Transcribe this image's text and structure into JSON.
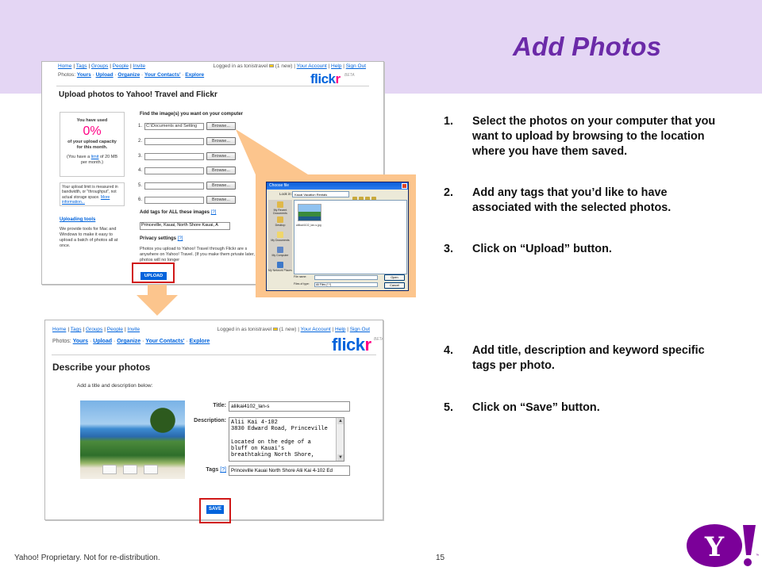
{
  "slide": {
    "title": "Add Photos",
    "footer": "Yahoo! Proprietary.   Not for re-distribution.",
    "page_number": "15",
    "logo_text": "Y!",
    "colors": {
      "header_band": "#e4d6f4",
      "title": "#6b2aa8",
      "highlight": "#d01818",
      "callout": "#fcc58d",
      "yahoo_purple": "#7b0099"
    }
  },
  "steps": [
    {
      "num": "1.",
      "text": "Select the photos on your computer that you want to upload by browsing to the location where you have them saved."
    },
    {
      "num": "2.",
      "text": "Add any tags that you’d like to have associated with the selected photos."
    },
    {
      "num": "3.",
      "text": "Click on “Upload” button."
    },
    {
      "num": "4.",
      "text": "Add title, description and keyword specific tags per photo."
    },
    {
      "num": "5.",
      "text": "Click on “Save” button."
    }
  ],
  "flickr_nav": {
    "links": [
      "Home",
      "Tags",
      "Groups",
      "People",
      "Invite"
    ],
    "logged_in": "Logged in as tonistravel",
    "mail": "(1 new)",
    "right_links": [
      "Your Account",
      "Help",
      "Sign Out"
    ],
    "photos_label": "Photos:",
    "photos_links": [
      "Yours",
      "Upload",
      "Organize",
      "Your Contacts'",
      "Explore"
    ],
    "logo_flick": "flick",
    "logo_r": "r",
    "beta": "BETA"
  },
  "upload_page": {
    "heading": "Upload photos to Yahoo! Travel and Flickr",
    "usage_line1": "You have used",
    "usage_pct": "0%",
    "usage_line2": "of your upload capacity for this month.",
    "usage_note_a": "(You have a",
    "usage_note_link": "limit",
    "usage_note_b": "of 20 MB per month.)",
    "limit_note": "Your upload limit is measured in bandwidth, or \"throughput\", not actual storage space.",
    "more_info": "More information...",
    "tools_heading": "Uploading tools",
    "tools_text": "We provide tools for Mac and Windows to make it easy to upload a batch of photos all at once.",
    "find_heading": "Find the image(s) you want on your computer",
    "files": [
      {
        "num": "1.",
        "value": "C:\\Documents and Setting"
      },
      {
        "num": "2.",
        "value": ""
      },
      {
        "num": "3.",
        "value": ""
      },
      {
        "num": "4.",
        "value": ""
      },
      {
        "num": "5.",
        "value": ""
      },
      {
        "num": "6.",
        "value": ""
      }
    ],
    "browse_label": "Browse...",
    "tags_heading": "Add tags for ALL these images",
    "help_link": "[?]",
    "tags_value": "Princeville, Kauai, North Shore Kauai, A",
    "privacy_heading": "Privacy settings",
    "privacy_text": "Photos you upload to Yahoo! Travel through Flickr are s anywhere on Yahoo! Travel. (If you make them private later, the photos will no longer",
    "upload_button": "UPLOAD"
  },
  "file_dialog": {
    "title": "Choose file",
    "look_in_label": "Look in:",
    "look_in_value": "Kauai Vacation Rentals",
    "places": [
      "My Recent Documents",
      "Desktop",
      "My Documents",
      "My Computer",
      "My Network Places"
    ],
    "file_caption": "aliikai4102_lan-s.jpg",
    "file_name_label": "File name:",
    "file_type_label": "Files of type:",
    "file_type_value": "All Files (*.*)",
    "open_button": "Open",
    "cancel_button": "Cancel"
  },
  "describe_page": {
    "heading": "Describe your photos",
    "hint": "Add a title and description below:",
    "title_label": "Title:",
    "title_value": "aliikai4102_lan-s",
    "description_label": "Description:",
    "description_value": "Alii Kai 4-102\n3830 Edward Road, Princeville\n\nLocated on the edge of a\nbluff on Kauai's\nbreathtaking North Shore,",
    "tags_label": "Tags",
    "help_link": "[?]",
    "tags_value": "Princeville Kauai North Shore Alii Kai 4-102 Ed",
    "save_button": "SAVE"
  }
}
